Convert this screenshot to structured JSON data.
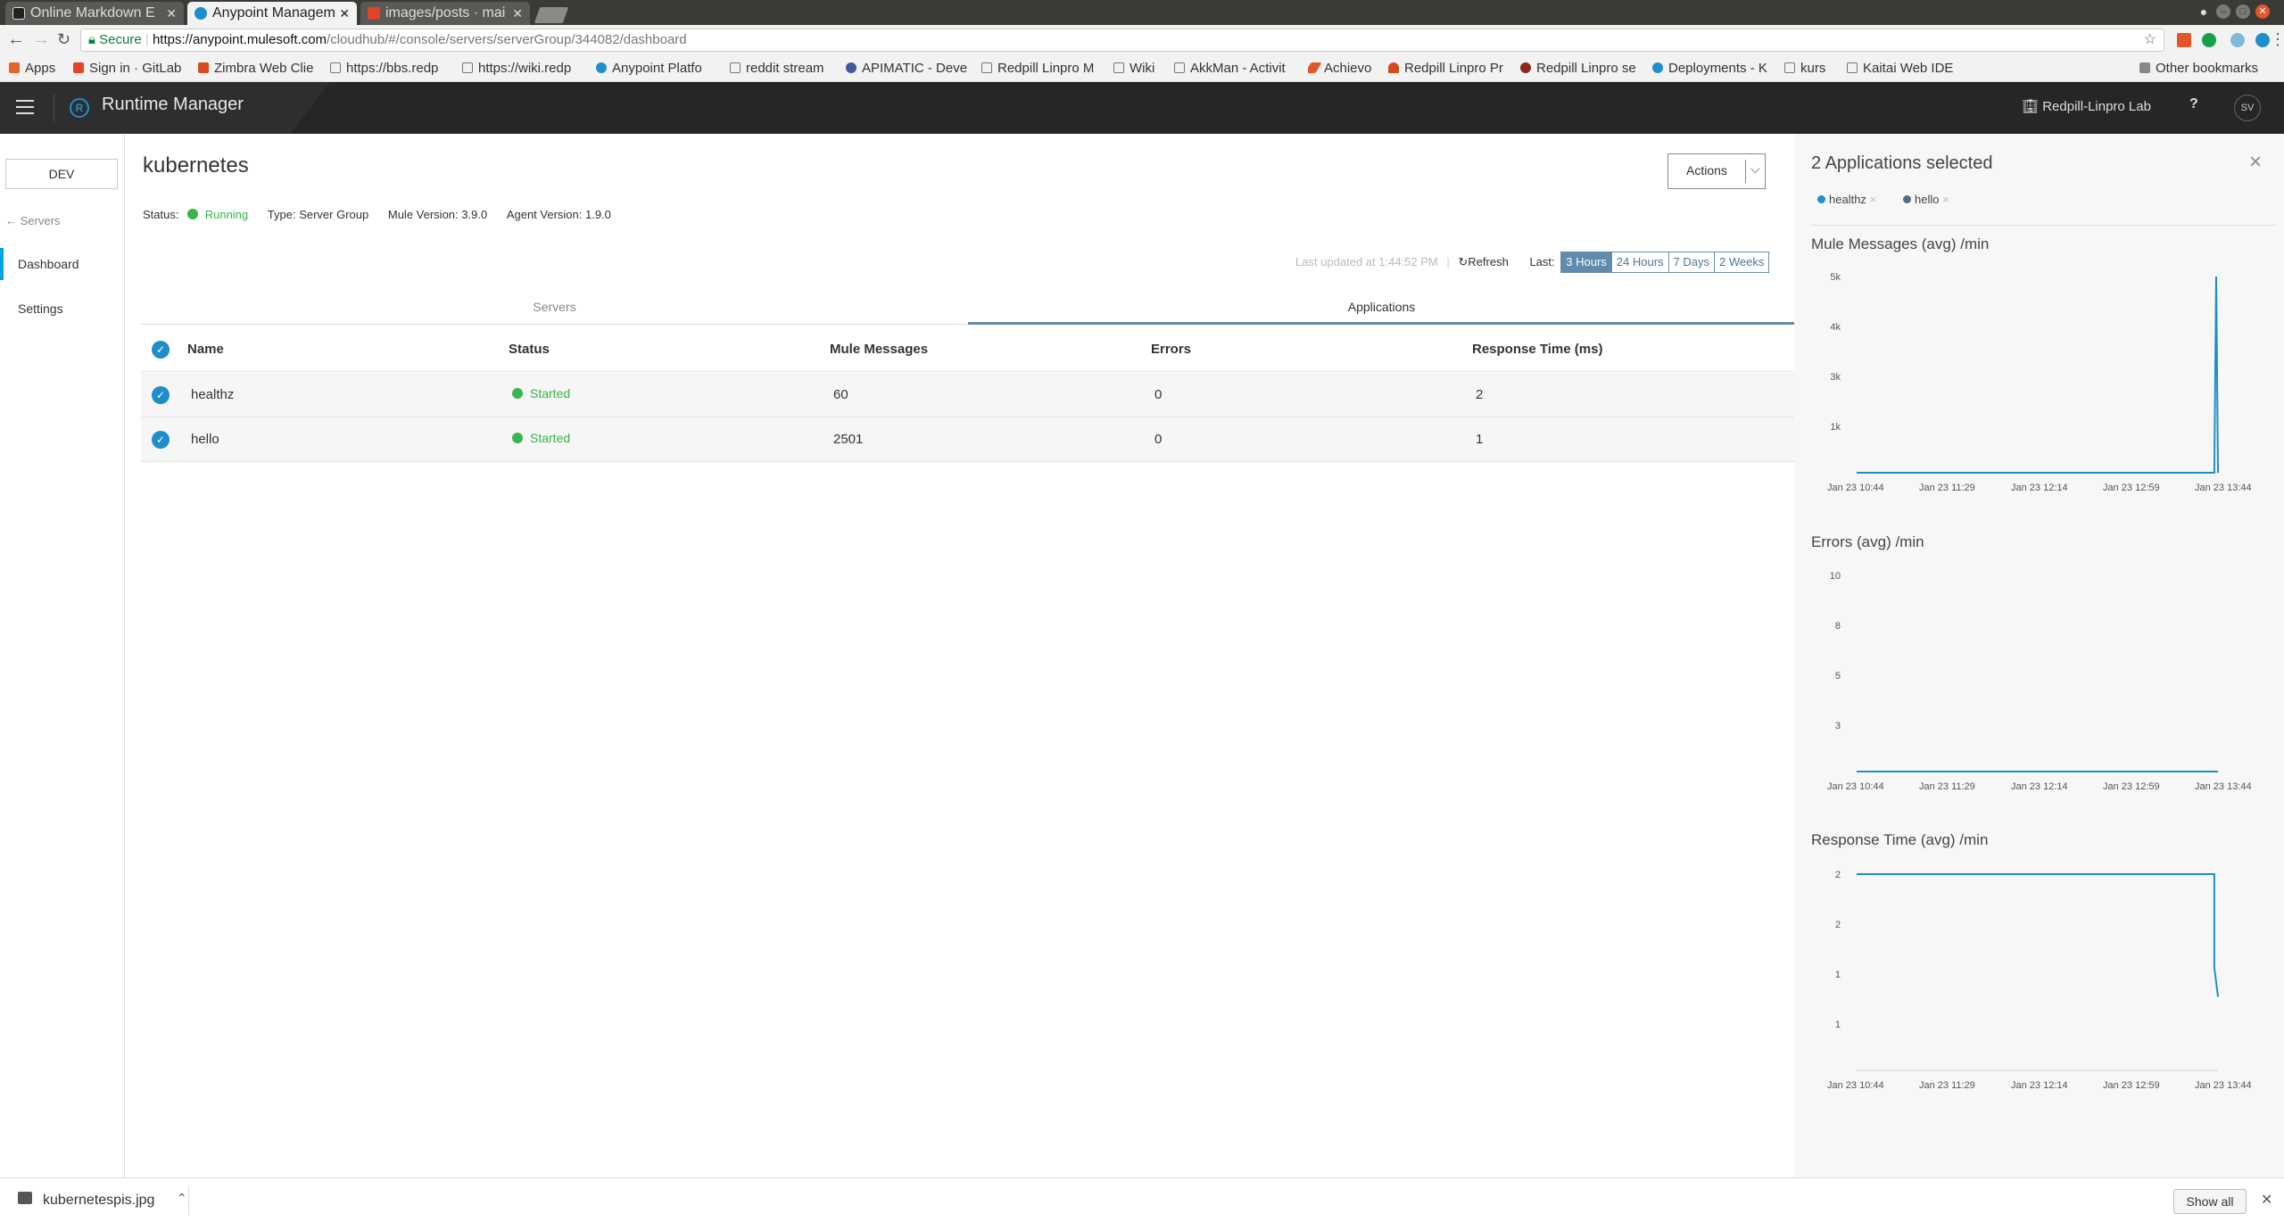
{
  "browser": {
    "tabs": [
      {
        "label": "Online Markdown E"
      },
      {
        "label": "Anypoint Managem"
      },
      {
        "label": "images/posts · mai"
      }
    ],
    "url": {
      "secure": "Secure",
      "host": "https://anypoint.mulesoft.com",
      "path": "/cloudhub/#/console/servers/serverGroup/344082/dashboard"
    },
    "bookmarks": [
      "Apps",
      "Sign in · GitLab",
      "Zimbra Web Clie",
      "https://bbs.redp",
      "https://wiki.redp",
      "Anypoint Platfo",
      "reddit stream",
      "APIMATIC - Deve",
      "Redpill Linpro M",
      "Wiki",
      "AkkMan - Activit",
      "Achievo",
      "Redpill Linpro Pr",
      "Redpill Linpro se",
      "Deployments - K",
      "kurs",
      "Kaitai Web IDE"
    ],
    "other_bookmarks": "Other bookmarks"
  },
  "header": {
    "title": "Runtime Manager",
    "org": "Redpill-Linpro Lab",
    "help": "?",
    "user_initials": "SV"
  },
  "leftnav": {
    "env": "DEV",
    "back": "Servers",
    "items": [
      "Dashboard",
      "Settings"
    ]
  },
  "server": {
    "name": "kubernetes",
    "actions_label": "Actions",
    "status_label": "Status:",
    "status_value": "Running",
    "type_label": "Type:",
    "type_value": "Server Group",
    "mule_version_label": "Mule Version:",
    "mule_version_value": "3.9.0",
    "agent_version_label": "Agent Version:",
    "agent_version_value": "1.9.0"
  },
  "refreshbar": {
    "last_updated": "Last updated at 1:44:52 PM",
    "separator": "|",
    "refresh_label": "Refresh",
    "last_label": "Last:",
    "ranges": [
      "3 Hours",
      "24 Hours",
      "7 Days",
      "2 Weeks"
    ],
    "selected_range": "3 Hours"
  },
  "tabs": {
    "servers": "Servers",
    "applications": "Applications",
    "active": "Applications"
  },
  "table": {
    "headers": [
      "Name",
      "Status",
      "Mule Messages",
      "Errors",
      "Response Time (ms)"
    ],
    "rows": [
      {
        "name": "healthz",
        "status": "Started",
        "messages": "60",
        "errors": "0",
        "response": "2"
      },
      {
        "name": "hello",
        "status": "Started",
        "messages": "2501",
        "errors": "0",
        "response": "1"
      }
    ]
  },
  "panel": {
    "title": "2 Applications selected",
    "close": "×",
    "chips": [
      {
        "name": "healthz",
        "x": "×"
      },
      {
        "name": "hello",
        "x": "×"
      }
    ]
  },
  "chart_data": [
    {
      "type": "line",
      "title": "Mule Messages (avg) /min",
      "xticks": [
        "Jan 23 10:44",
        "Jan 23 11:29",
        "Jan 23 12:14",
        "Jan 23 12:59",
        "Jan 23 13:44"
      ],
      "yticks": [
        "5k",
        "4k",
        "3k",
        "1k"
      ],
      "ylim": [
        0,
        5000
      ],
      "series": [
        {
          "color": "#1e8ec8",
          "x": [
            0,
            0.985,
            0.99,
            0.995,
            1.0
          ],
          "values": [
            0,
            0,
            0,
            5000,
            0
          ]
        }
      ]
    },
    {
      "type": "line",
      "title": "Errors (avg) /min",
      "xticks": [
        "Jan 23 10:44",
        "Jan 23 11:29",
        "Jan 23 12:14",
        "Jan 23 12:59",
        "Jan 23 13:44"
      ],
      "yticks": [
        "10",
        "8",
        "5",
        "3"
      ],
      "ylim": [
        0,
        10
      ],
      "series": [
        {
          "color": "#1e8ec8",
          "x": [
            0,
            1.0
          ],
          "values": [
            0,
            0
          ]
        }
      ]
    },
    {
      "type": "line",
      "title": "Response Time (avg) /min",
      "xticks": [
        "Jan 23 10:44",
        "Jan 23 11:29",
        "Jan 23 12:14",
        "Jan 23 12:59",
        "Jan 23 13:44"
      ],
      "yticks": [
        "2",
        "2",
        "1",
        "1"
      ],
      "ylim": [
        0,
        2
      ],
      "series": [
        {
          "color": "#1e8ec8",
          "x": [
            0,
            0.985,
            0.99,
            0.99,
            1.0
          ],
          "values": [
            2,
            2,
            2,
            1.05,
            0.75
          ]
        }
      ]
    }
  ],
  "download": {
    "filename": "kubernetespis.jpg",
    "show_all": "Show all"
  },
  "colors": {
    "accent": "#1e8ec8",
    "started": "#3ab54a",
    "header_bg": "#262626"
  }
}
